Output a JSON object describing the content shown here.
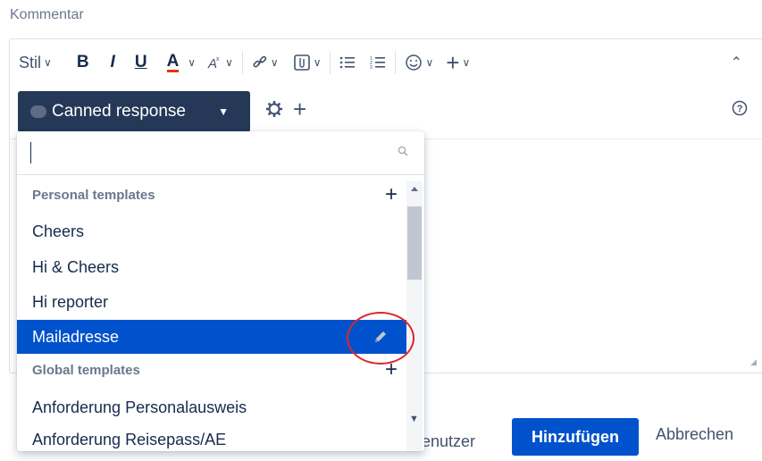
{
  "field_label": "Kommentar",
  "toolbar": {
    "style_label": "Stil",
    "bold": "B",
    "italic": "I",
    "underline": "U",
    "text_color": "A",
    "plus": "+"
  },
  "canned": {
    "button_label": "Canned response",
    "plus": "+"
  },
  "dropdown": {
    "search_value": "",
    "personal_header": "Personal templates",
    "personal_items": [
      "Cheers",
      "Hi & Cheers",
      "Hi reporter",
      "Mailadresse"
    ],
    "selected_item": "Mailadresse",
    "global_header": "Global templates",
    "global_items": [
      "Anforderung Personalausweis",
      "Anforderung Reisepass/AE"
    ],
    "add_symbol": "+"
  },
  "footer": {
    "partial_text": "enutzer",
    "add_button": "Hinzufügen",
    "cancel_link": "Abbrechen"
  },
  "colors": {
    "primary": "#0052cc",
    "canned_bg": "#253858",
    "highlight_circle": "#e0242b",
    "text_color_underline": "#de350b"
  },
  "icons": [
    "chevron-down-icon",
    "bold-icon",
    "italic-icon",
    "underline-icon",
    "text-color-icon",
    "clear-format-icon",
    "link-icon",
    "attachment-icon",
    "bullet-list-icon",
    "numbered-list-icon",
    "emoji-icon",
    "insert-plus-icon",
    "collapse-icon",
    "help-icon",
    "gear-icon",
    "search-icon",
    "pencil-icon"
  ]
}
